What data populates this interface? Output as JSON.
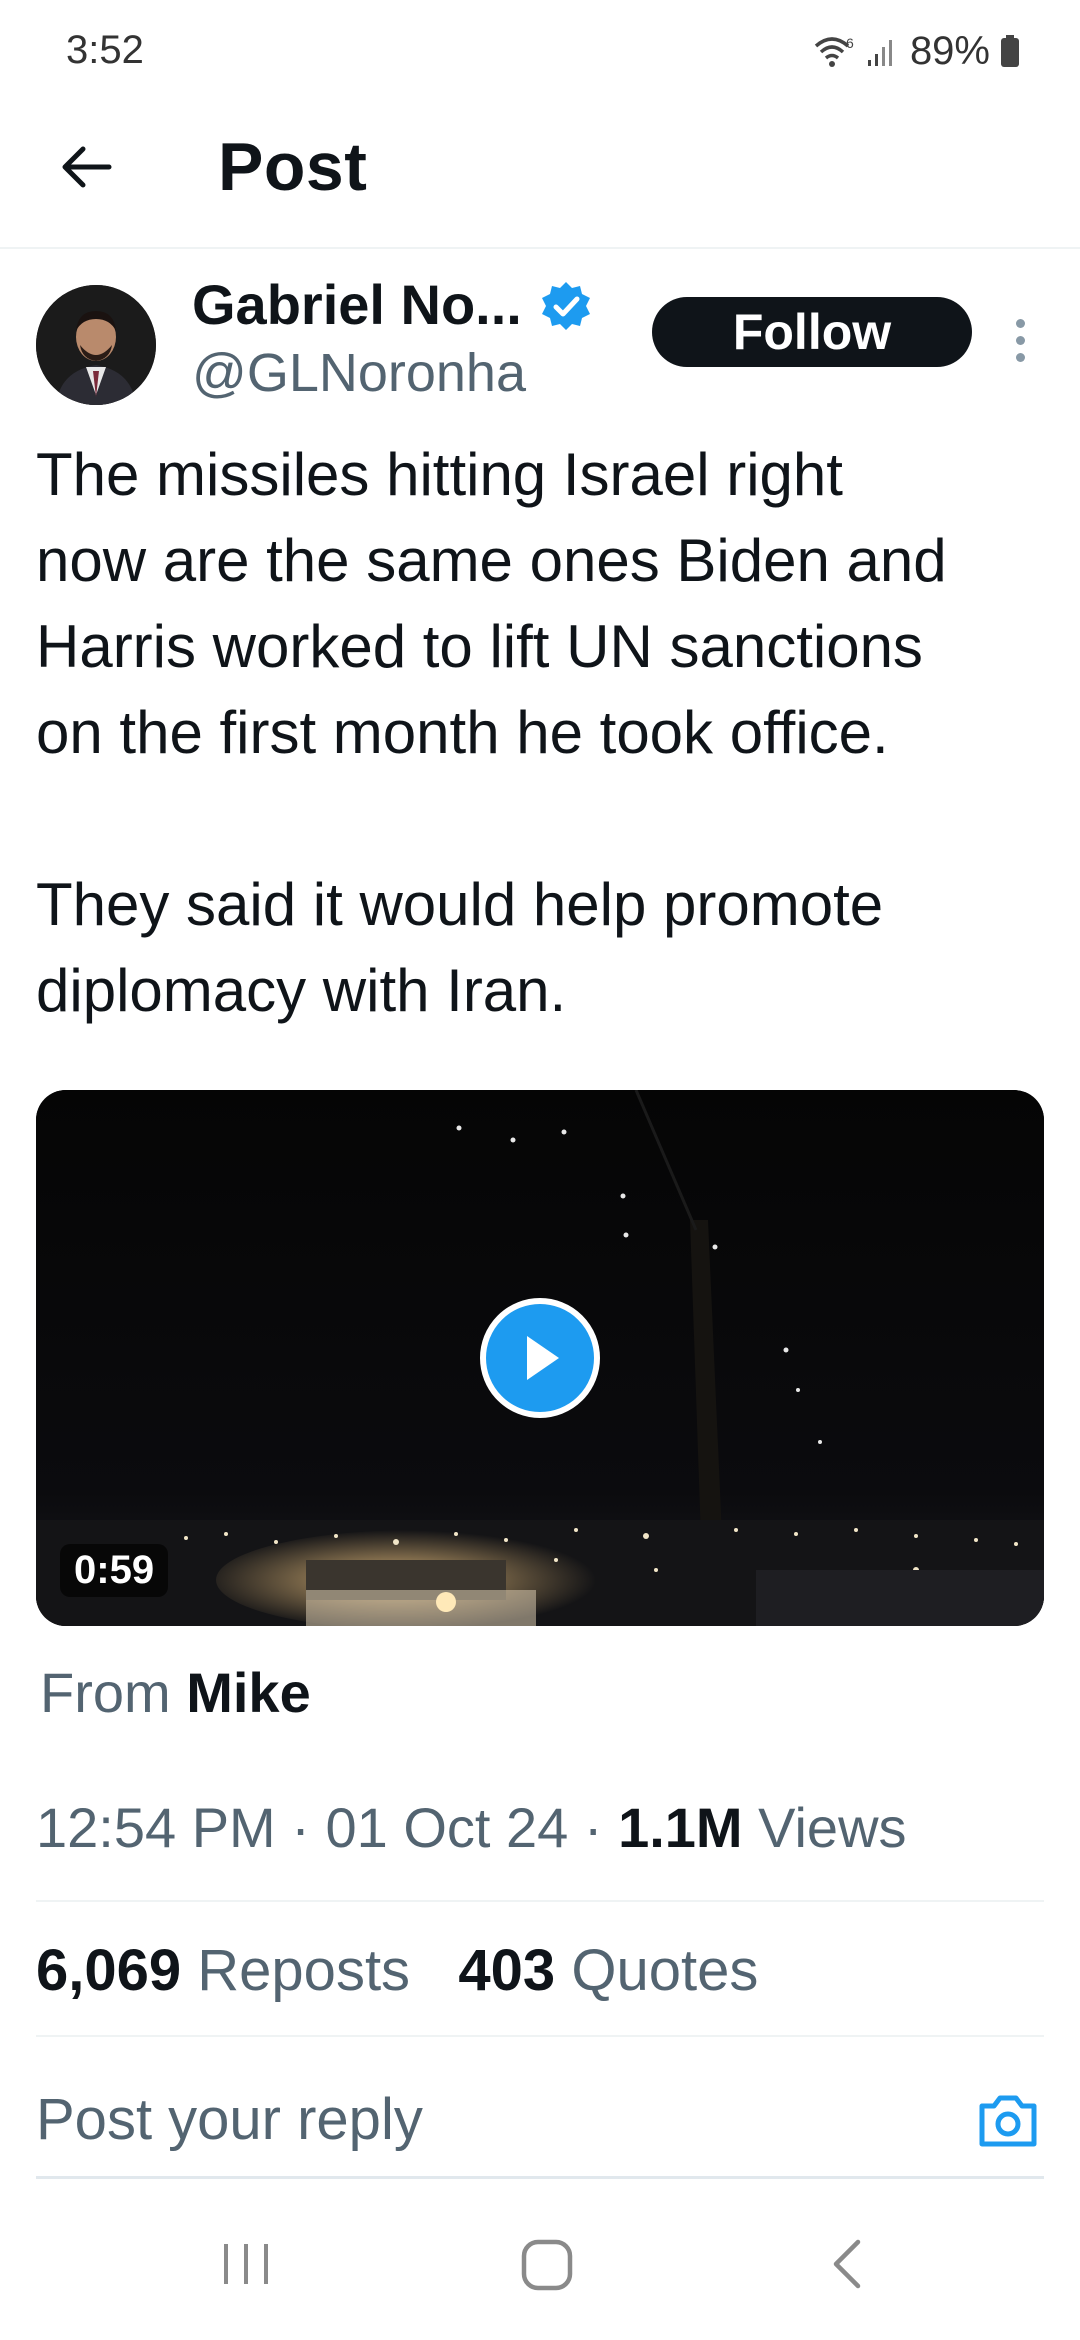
{
  "status_bar": {
    "time": "3:52",
    "battery": "89%",
    "wifi_label": "6",
    "icons": [
      "wifi-icon",
      "signal-icon",
      "battery-icon"
    ]
  },
  "header": {
    "title": "Post",
    "back_icon": "arrow-left-icon"
  },
  "author": {
    "display_name": "Gabriel No...",
    "handle": "@GLNoronha",
    "verified": true,
    "follow_label": "Follow"
  },
  "post": {
    "text": "The missiles hitting Israel right\nnow are the same ones Biden and\nHarris worked to lift UN sanctions\non the first month he took office.\n\nThey said it would help promote\ndiplomacy with Iran.",
    "video": {
      "duration": "0:59",
      "play_icon": "play-icon"
    },
    "from_prefix": "From",
    "from_name": "Mike",
    "time": "12:54 PM",
    "separator": "·",
    "date": "01 Oct 24",
    "views_count": "1.1M",
    "views_label": "Views"
  },
  "stats": {
    "reposts_count": "6,069",
    "reposts_label": "Reposts",
    "quotes_count": "403",
    "quotes_label": "Quotes"
  },
  "reply": {
    "placeholder": "Post your reply",
    "camera_icon": "camera-icon"
  },
  "colors": {
    "accent": "#1d9bf0",
    "text_primary": "#0f1419",
    "text_secondary": "#536471",
    "follow_bg": "#0f1419"
  },
  "nav_bar": {
    "icons": [
      "recents-icon",
      "home-icon",
      "back-icon"
    ]
  }
}
